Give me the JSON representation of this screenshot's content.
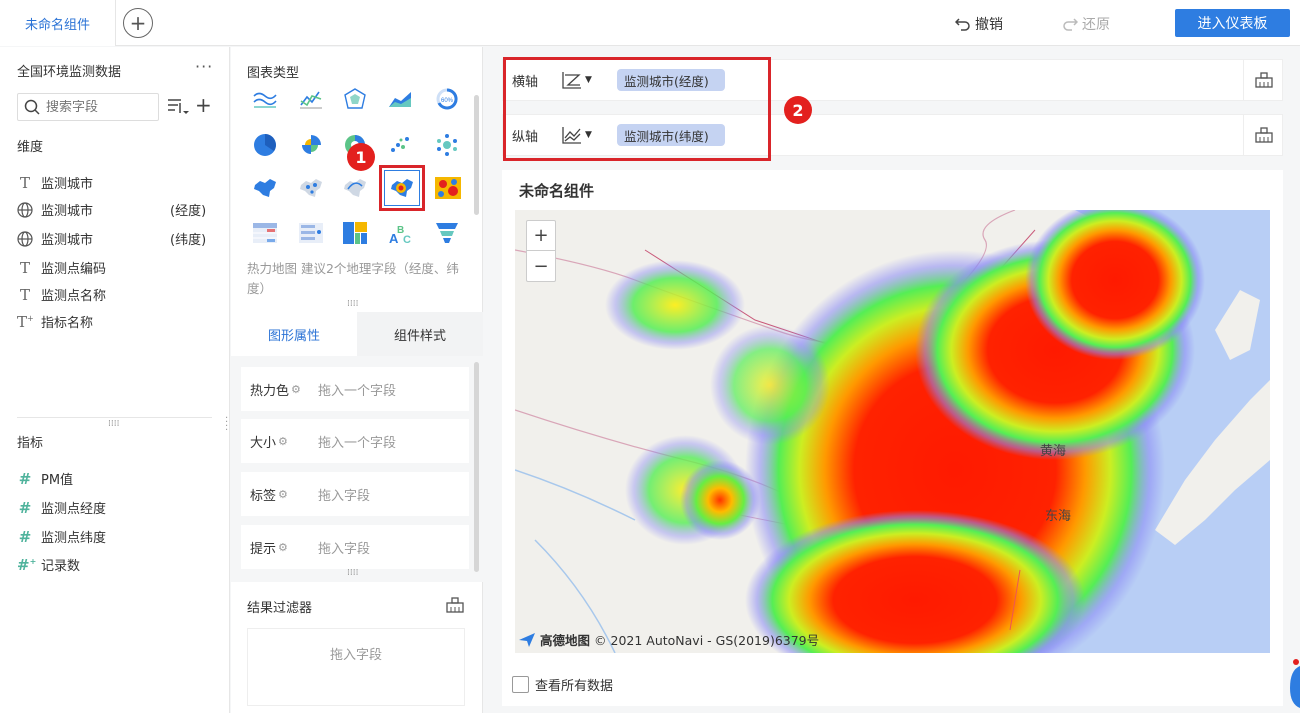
{
  "topbar": {
    "tab_label": "未命名组件",
    "undo_label": "撤销",
    "redo_label": "还原",
    "enter_dashboard_label": "进入仪表板"
  },
  "data_panel": {
    "dataset_title": "全国环境监测数据",
    "search_placeholder": "搜索字段",
    "dimensions_label": "维度",
    "dimensions": [
      {
        "label": "监测城市",
        "suffix": "",
        "icon": "text-field-icon"
      },
      {
        "label": "监测城市",
        "suffix": "(经度)",
        "icon": "globe-icon"
      },
      {
        "label": "监测城市",
        "suffix": "(纬度)",
        "icon": "globe-icon"
      },
      {
        "label": "监测点编码",
        "suffix": "",
        "icon": "text-field-icon"
      },
      {
        "label": "监测点名称",
        "suffix": "",
        "icon": "text-field-icon"
      },
      {
        "label": "指标名称",
        "suffix": "",
        "icon": "text-field-icon"
      }
    ],
    "measures_label": "指标",
    "measures": [
      {
        "label": "PM值",
        "icon": "number-field-icon"
      },
      {
        "label": "监测点经度",
        "icon": "number-field-icon"
      },
      {
        "label": "监测点纬度",
        "icon": "number-field-icon"
      },
      {
        "label": "记录数",
        "icon": "number-field-icon"
      }
    ]
  },
  "chart_panel": {
    "chart_type_label": "图表类型",
    "hint": "热力地图 建议2个地理字段（经度、纬度）",
    "annotation_1": "1",
    "tabs": {
      "properties": "图形属性",
      "style": "组件样式"
    },
    "property_rows": [
      {
        "label": "热力色",
        "value": "拖入一个字段"
      },
      {
        "label": "大小",
        "value": "拖入一个字段"
      },
      {
        "label": "标签",
        "value": "拖入字段"
      },
      {
        "label": "提示",
        "value": "拖入字段"
      }
    ],
    "result_filter_label": "结果过滤器",
    "result_filter_drop": "拖入字段"
  },
  "axes": {
    "x_label": "横轴",
    "x_field": "监测城市(经度)",
    "y_label": "纵轴",
    "y_field": "监测城市(纬度)",
    "annotation_2": "2"
  },
  "widget": {
    "title": "未命名组件",
    "zoom_in": "+",
    "zoom_out": "−",
    "map_logo": "高德地图",
    "map_credit": "© 2021 AutoNavi - GS(2019)6379号",
    "sea_label_1": "黄海",
    "sea_label_2": "东海",
    "show_all_label": "查看所有数据"
  },
  "colors": {
    "accent": "#2e7de1",
    "highlight_box": "#d9252a",
    "pill_bg": "#c5d3f2"
  }
}
